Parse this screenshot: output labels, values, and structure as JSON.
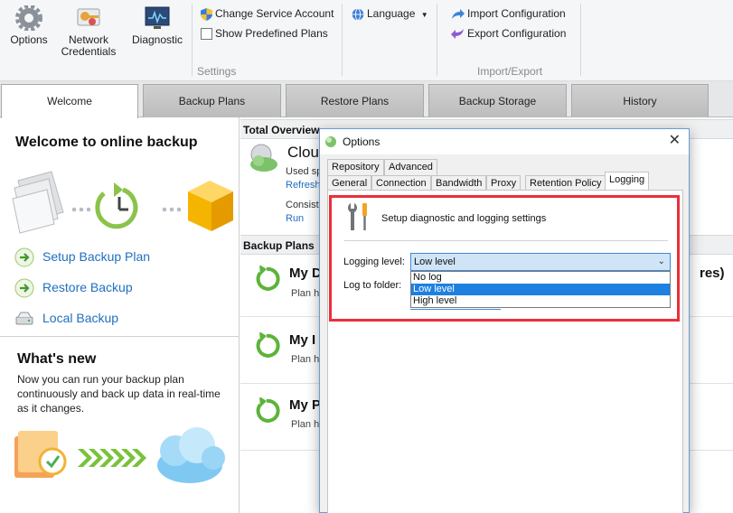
{
  "ribbon": {
    "options_label": "Options",
    "network_label": "Network Credentials",
    "network_line1": "Network",
    "network_line2": "Credentials",
    "diagnostic_label": "Diagnostic",
    "change_service_account": "Change Service Account",
    "show_predefined_plans": "Show Predefined Plans",
    "settings_group": "Settings",
    "language_label": "Language",
    "import_configuration": "Import Configuration",
    "export_configuration": "Export Configuration",
    "import_export_group": "Import/Export"
  },
  "tabs": [
    {
      "label": "Welcome",
      "active": true
    },
    {
      "label": "Backup Plans",
      "active": false
    },
    {
      "label": "Restore Plans",
      "active": false
    },
    {
      "label": "Backup Storage",
      "active": false
    },
    {
      "label": "History",
      "active": false
    }
  ],
  "left_panel": {
    "welcome_title": "Welcome to online backup",
    "links": [
      "Setup Backup Plan",
      "Restore Backup",
      "Local Backup"
    ],
    "whats_new_title": "What's new",
    "whats_new_text": "Now you can run your backup plan continuously and back up data in real-time as it changes."
  },
  "overview": {
    "header": "Total Overview",
    "storage_name": "Clou",
    "used_text": "Used sp",
    "refresh_link": "Refresh",
    "consistency_text": "Consiste",
    "run_link": "Run"
  },
  "backup_plans": {
    "header": "Backup Plans",
    "right_fragment": "res)",
    "plans": [
      {
        "name": "My D",
        "sub": "Plan ha"
      },
      {
        "name": "My I",
        "sub": "Plan ha"
      },
      {
        "name": "My P",
        "sub": "Plan ha"
      }
    ]
  },
  "dialog": {
    "title": "Options",
    "close_glyph": "✕",
    "tabs_row1": [
      "Repository",
      "Advanced"
    ],
    "tabs_row2": [
      "General",
      "Connection",
      "Bandwidth",
      "Proxy",
      "Retention Policy",
      "Logging"
    ],
    "active_tab": "Logging",
    "setup_text": "Setup diagnostic and logging settings",
    "logging_level_label": "Logging level:",
    "logging_level_value": "Low level",
    "logging_level_options": [
      "No log",
      "Low level",
      "High level"
    ],
    "log_to_folder_label": "Log to folder:"
  },
  "colors": {
    "highlight": "#e8303a",
    "link": "#1f6fbf",
    "selection": "#1e80e0"
  }
}
